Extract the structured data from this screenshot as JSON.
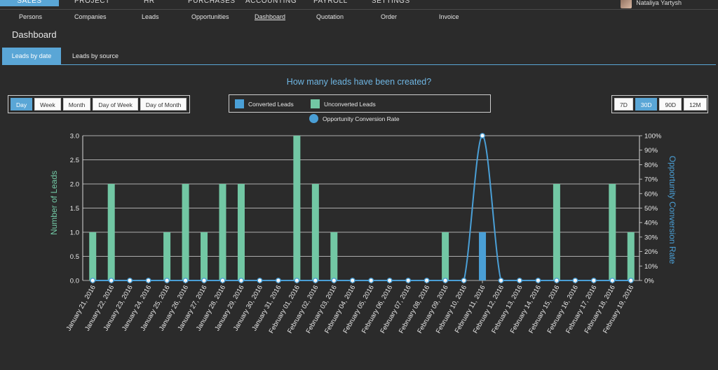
{
  "top_menu": {
    "items": [
      "SALES",
      "PROJECT",
      "HR",
      "PURCHASES",
      "ACCOUNTING",
      "PAYROLL",
      "SETTINGS"
    ],
    "active": "SALES"
  },
  "user": {
    "name": "Nataliya Yartysh"
  },
  "sub_menu": {
    "items": [
      "Persons",
      "Companies",
      "Leads",
      "Opportunities",
      "Dashboard",
      "Quotation",
      "Order",
      "Invoice"
    ],
    "active": "Dashboard"
  },
  "page": {
    "title": "Dashboard"
  },
  "tabs": [
    {
      "label": "Leads by date",
      "active": true
    },
    {
      "label": "Leads by source",
      "active": false
    }
  ],
  "period_buttons": [
    {
      "label": "Day",
      "active": true
    },
    {
      "label": "Week",
      "active": false
    },
    {
      "label": "Month",
      "active": false
    },
    {
      "label": "Day of Week",
      "active": false
    },
    {
      "label": "Day of Month",
      "active": false
    }
  ],
  "range_buttons": [
    {
      "label": "7D",
      "active": false
    },
    {
      "label": "30D",
      "active": true
    },
    {
      "label": "90D",
      "active": false
    },
    {
      "label": "12M",
      "active": false
    }
  ],
  "legend": {
    "converted": "Converted Leads",
    "unconverted": "Unconverted Leads",
    "rate": "Opportunity Conversion Rate"
  },
  "colors": {
    "converted": "#4a9fd6",
    "unconverted": "#72c7a4",
    "line": "#4a9fd6",
    "accent": "#5aa6d6"
  },
  "chart_data": {
    "type": "bar",
    "title": "How many leads have been created?",
    "ylabel": "Number of Leads",
    "y2label": "Opportunity Conversion Rate",
    "ylim": [
      0,
      3
    ],
    "yticks": [
      "0.0",
      "0.5",
      "1.0",
      "1.5",
      "2.0",
      "2.5",
      "3.0"
    ],
    "y2lim": [
      0,
      100
    ],
    "y2ticks": [
      "0%",
      "10%",
      "20%",
      "30%",
      "40%",
      "50%",
      "60%",
      "70%",
      "80%",
      "90%",
      "100%"
    ],
    "grid": true,
    "categories": [
      "January 21, 2016",
      "January 22, 2016",
      "January 23, 2016",
      "January 24, 2016",
      "January 25, 2016",
      "January 26, 2016",
      "January 27, 2016",
      "January 28, 2016",
      "January 29, 2016",
      "January 30, 2016",
      "January 31, 2016",
      "February 01, 2016",
      "February 02, 2016",
      "February 03, 2016",
      "February 04, 2016",
      "February 05, 2016",
      "February 06, 2016",
      "February 07, 2016",
      "February 08, 2016",
      "February 09, 2016",
      "February 10, 2016",
      "February 11, 2016",
      "February 12, 2016",
      "February 13, 2016",
      "February 14, 2016",
      "February 15, 2016",
      "February 16, 2016",
      "February 17, 2016",
      "February 18, 2016",
      "February 19, 2016"
    ],
    "series": [
      {
        "name": "Converted Leads",
        "values": [
          0,
          0,
          0,
          0,
          0,
          0,
          0,
          0,
          0,
          0,
          0,
          0,
          0,
          0,
          0,
          0,
          0,
          0,
          0,
          0,
          0,
          1,
          0,
          0,
          0,
          0,
          0,
          0,
          0,
          0
        ]
      },
      {
        "name": "Unconverted Leads",
        "values": [
          1,
          2,
          0,
          0,
          1,
          2,
          1,
          2,
          2,
          0,
          0,
          3,
          2,
          1,
          0,
          0,
          0,
          0,
          0,
          1,
          0,
          0,
          0,
          0,
          0,
          2,
          0,
          0,
          2,
          1
        ]
      },
      {
        "name": "Opportunity Conversion Rate",
        "values": [
          0,
          0,
          0,
          0,
          0,
          0,
          0,
          0,
          0,
          0,
          0,
          0,
          0,
          0,
          0,
          0,
          0,
          0,
          0,
          0,
          0,
          100,
          0,
          0,
          0,
          0,
          0,
          0,
          0,
          0
        ]
      }
    ]
  }
}
